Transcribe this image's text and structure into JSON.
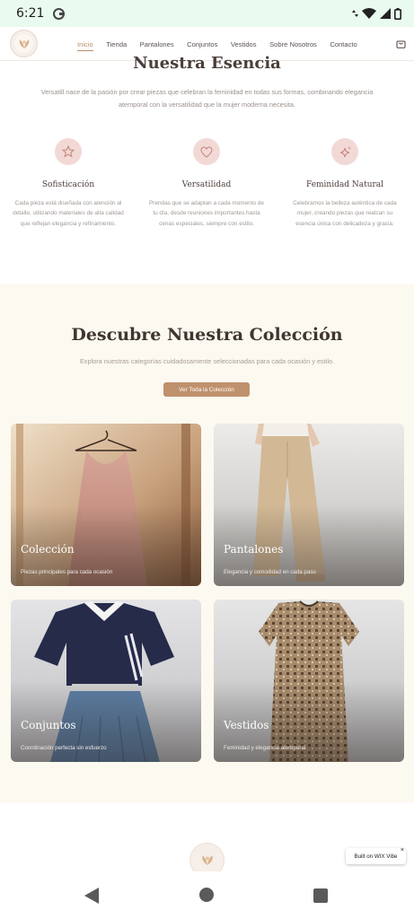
{
  "status_bar": {
    "time": "6:21"
  },
  "header": {
    "logo": "versatill-logo",
    "nav": [
      "Inicio",
      "Tienda",
      "Pantalones",
      "Conjuntos",
      "Vestidos",
      "Sobre Nosotros",
      "Contacto"
    ],
    "active_nav": "Inicio",
    "cart_icon": "shopping-bag-icon"
  },
  "esencia": {
    "title": "Nuestra Esencia",
    "text": "Versatill nace de la pasión por crear piezas que celebran la feminidad en todas sus formas, combinando elegancia atemporal con la versatilidad que la mujer moderna necesita.",
    "features": [
      {
        "icon": "star-icon",
        "title": "Sofisticación",
        "text": "Cada pieza está diseñada con atención al detalle, utilizando materiales de alta calidad que reflejan elegancia y refinamiento."
      },
      {
        "icon": "heart-icon",
        "title": "Versatilidad",
        "text": "Prendas que se adaptan a cada momento de tu día, desde reuniones importantes hasta cenas especiales, siempre con estilo."
      },
      {
        "icon": "sparkle-icon",
        "title": "Feminidad Natural",
        "text": "Celebramos la belleza auténtica de cada mujer, creando piezas que realzan su esencia única con delicadeza y gracia."
      }
    ]
  },
  "coleccion": {
    "title": "Descubre Nuestra Colección",
    "subtitle": "Explora nuestras categorías cuidadosamente seleccionadas para cada ocasión y estilo.",
    "button": "Ver Toda la Colección",
    "cards": [
      {
        "title": "Colección",
        "subtitle": "Piezas principales para cada ocasión"
      },
      {
        "title": "Pantalones",
        "subtitle": "Elegancia y comodidad en cada paso"
      },
      {
        "title": "Conjuntos",
        "subtitle": "Coordinación perfecta sin esfuerzo"
      },
      {
        "title": "Vestidos",
        "subtitle": "Feminidad y elegancia atemporal"
      }
    ]
  },
  "wix_badge": {
    "text": "Built on WIX Vibe",
    "close": "×"
  },
  "colors": {
    "accent": "#bf916d",
    "section_bg": "#fcf9f0",
    "icon_bg": "#f2d9d6",
    "status_bg": "#e9faee"
  }
}
